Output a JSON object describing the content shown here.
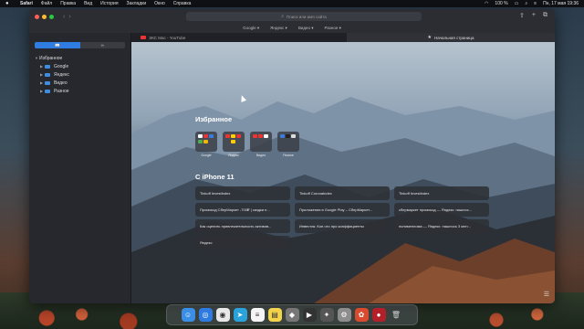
{
  "menubar": {
    "apple": "",
    "items": [
      "Safari",
      "Файл",
      "Правка",
      "Вид",
      "История",
      "Закладки",
      "Окно",
      "Справка"
    ],
    "battery": "100 %",
    "datetime": "Пн, 17 мая  19:36"
  },
  "safari": {
    "address_placeholder": "Поиск или имя сайта",
    "favorites_bar": [
      "Google ▾",
      "Яндекс ▾",
      "Видео ▾",
      "Разное ▾"
    ],
    "tabs": [
      {
        "title": "ЭКС Mac - YouTube"
      },
      {
        "title": "Начальная страница"
      }
    ]
  },
  "sidebar": {
    "segments": [
      "📖",
      "∞"
    ],
    "root": "Избранное",
    "folders": [
      "Google",
      "Яндекс",
      "Видео",
      "Разное"
    ]
  },
  "startpage": {
    "favorites_title": "Избранное",
    "favorites": [
      {
        "label": "Google"
      },
      {
        "label": "Яндекс"
      },
      {
        "label": "Видео"
      },
      {
        "label": "Разное"
      }
    ],
    "iphone_title": "С iPhone 11",
    "iphone_tabs": [
      "Tinkoff InvestIndex",
      "Tinkoff CoronaIndex",
      "Tinkoff InvestIndex",
      "Промокод СберМаркет -700₽ | скидки н...",
      "Приложения в Google Play – СберМаркет...",
      "сбермаркет промокод — Яндекс: нашлос...",
      "Как оценить привлекательность активов...",
      "Инвестик. Кое-что про коэффициенты",
      "полимеплома — Яндекс: нашлось 3 млн...",
      "Яндекс"
    ]
  }
}
